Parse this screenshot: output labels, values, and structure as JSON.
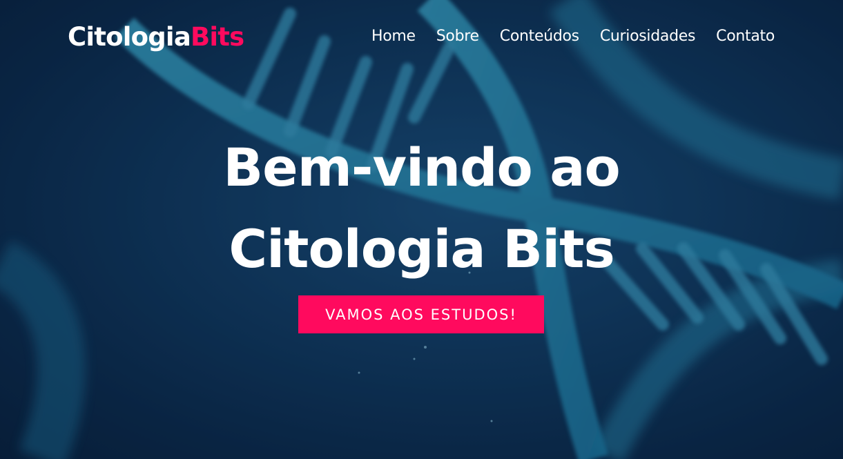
{
  "brand": {
    "name_main": "Citologia",
    "name_accent": "Bits",
    "accent_color": "#ff0a5e"
  },
  "nav": {
    "items": [
      "Home",
      "Sobre",
      "Conteúdos",
      "Curiosidades",
      "Contato"
    ]
  },
  "hero": {
    "title_line1": "Bem-vindo ao",
    "title_line2": "Citologia Bits",
    "cta_label": "VAMOS AOS ESTUDOS!",
    "background": "dna-helix-image"
  }
}
